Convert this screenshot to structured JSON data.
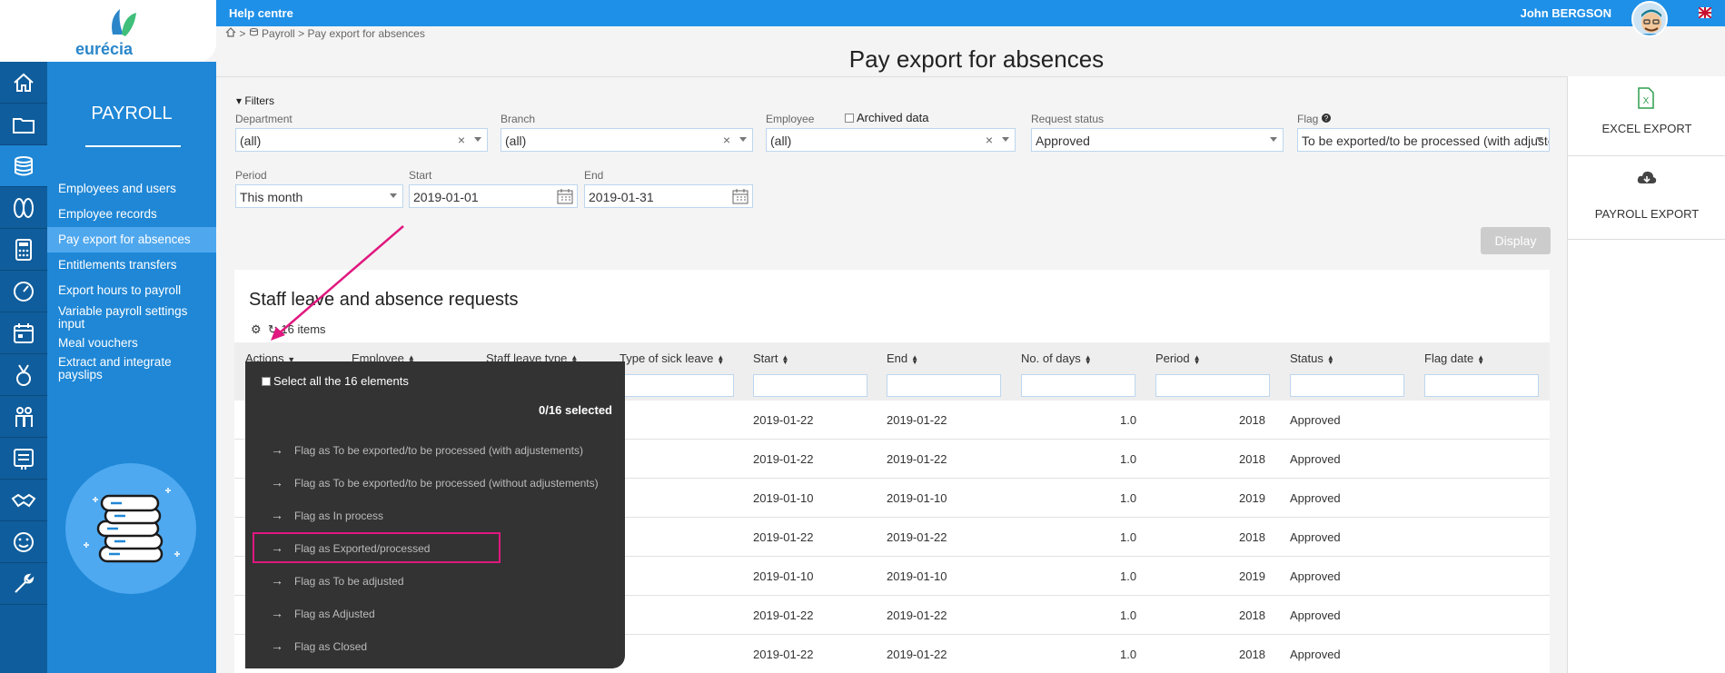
{
  "topbar": {
    "help": "Help centre",
    "user": "John  BERGSON"
  },
  "logo": {
    "text": "eurécia"
  },
  "rail_icons": [
    "home-icon",
    "folder-icon",
    "coins-icon",
    "flip-flops-icon",
    "calculator-icon",
    "dashboard-icon",
    "calendar-icon",
    "medal-icon",
    "people-icon",
    "checklist-icon",
    "handshake-icon",
    "smiley-icon",
    "wrench-icon"
  ],
  "sidebar": {
    "module": "PAYROLL",
    "items": [
      "Employees and users",
      "Employee records",
      "Pay export for absences",
      "Entitlements transfers",
      "Export hours to payroll",
      "Variable payroll settings input",
      "Meal vouchers",
      "Extract and integrate payslips"
    ]
  },
  "breadcrumb": {
    "payroll": "Payroll",
    "current": "Pay export for absences",
    "sep": ">"
  },
  "page_title": "Pay export for absences",
  "filters": {
    "toggle": "Filters",
    "department": {
      "label": "Department",
      "value": "(all)"
    },
    "branch": {
      "label": "Branch",
      "value": "(all)"
    },
    "employee": {
      "label": "Employee",
      "value": "(all)"
    },
    "archived": "Archived data",
    "request_status": {
      "label": "Request status",
      "value": "Approved"
    },
    "flag": {
      "label": "Flag",
      "value": "To be exported/to be processed (with adjustements)"
    },
    "period": {
      "label": "Period",
      "value": "This month"
    },
    "start": {
      "label": "Start",
      "value": "2019-01-01"
    },
    "end": {
      "label": "End",
      "value": "2019-01-31"
    },
    "display_btn": "Display"
  },
  "export": {
    "excel": "EXCEL EXPORT",
    "payroll": "PAYROLL EXPORT"
  },
  "table": {
    "title": "Staff leave and absence requests",
    "items_count": "16 items",
    "columns": [
      "Actions",
      "Employee",
      "Staff leave type",
      "Type of sick leave",
      "Start",
      "End",
      "No. of days",
      "Period",
      "Status",
      "Flag date"
    ],
    "rows": [
      {
        "start": "2019-01-22",
        "end": "2019-01-22",
        "days": "1.0",
        "period": "2018",
        "status": "Approved"
      },
      {
        "start": "2019-01-22",
        "end": "2019-01-22",
        "days": "1.0",
        "period": "2018",
        "status": "Approved"
      },
      {
        "start": "2019-01-10",
        "end": "2019-01-10",
        "days": "1.0",
        "period": "2019",
        "status": "Approved"
      },
      {
        "start": "2019-01-22",
        "end": "2019-01-22",
        "days": "1.0",
        "period": "2018",
        "status": "Approved"
      },
      {
        "start": "2019-01-10",
        "end": "2019-01-10",
        "days": "1.0",
        "period": "2019",
        "status": "Approved"
      },
      {
        "start": "2019-01-22",
        "end": "2019-01-22",
        "days": "1.0",
        "period": "2018",
        "status": "Approved"
      },
      {
        "start": "2019-01-22",
        "end": "2019-01-22",
        "days": "1.0",
        "period": "2018",
        "status": "Approved"
      }
    ]
  },
  "actions_menu": {
    "select_all": "Select all the 16 elements",
    "selected": "0/16 selected",
    "items": [
      "Flag as To be exported/to be processed (with adjustements)",
      "Flag as To be exported/to be processed (without adjustements)",
      "Flag as In process",
      "Flag as Exported/processed",
      "Flag as To be adjusted",
      "Flag as Adjusted",
      "Flag as Closed"
    ]
  },
  "colors": {
    "topbar": "#1e90e8",
    "sidebar": "#1f87d6",
    "rail": "#0f5d9c",
    "highlight": "#e0187f",
    "menu": "#333333"
  }
}
